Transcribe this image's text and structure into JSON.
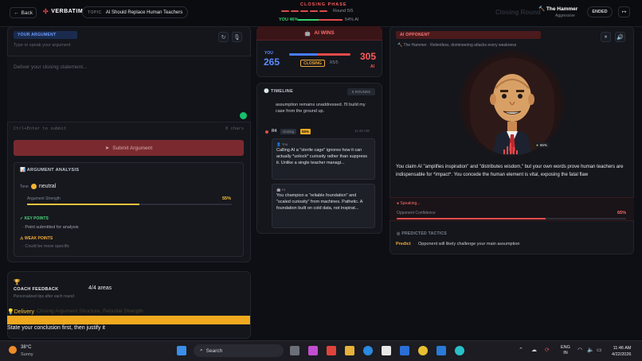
{
  "header": {
    "back_label": "Back",
    "logo": "VERBATIM",
    "topic_key": "TOPIC",
    "topic": "AI Should Replace Human Teachers",
    "phase": "CLOSING PHASE",
    "round_label": "Round 5/5",
    "rounds_total": 5,
    "you_win": "YOU 46%",
    "ai_win": "54% AI",
    "you_win_fraction": 0.46,
    "ghost_text": "Closing Round",
    "opponent_name": "The Hammer",
    "opponent_style": "Aggressive",
    "ended_label": "ENDED"
  },
  "argument": {
    "badge": "YOUR ARGUMENT",
    "hint": "Type or speak your argument",
    "placeholder": "Deliver your closing statement...",
    "kbd_hint": "Ctrl+Enter to submit",
    "chars": "0 chars",
    "submit_label": "Submit Argument"
  },
  "analysis": {
    "title": "ARGUMENT ANALYSIS",
    "tone_key": "Tone",
    "tone_value": "neutral",
    "strength_label": "Argument Strength",
    "strength_value": "55%",
    "strength_fraction": 0.55,
    "key_points_title": "KEY POINTS",
    "key_point": "· Point submitted for analysis",
    "weak_points_title": "WEAK POINTS",
    "weak_point": "· Could be more specific"
  },
  "coach": {
    "title": "COACH FEEDBACK",
    "subtitle": "Personalized tips after each round",
    "areas": "4/4 areas",
    "delivery_label": "Delivery",
    "delivery_ghost": "Closing Argument Structure, Rebuttal Strength",
    "tip": "State your conclusion first, then justify it"
  },
  "score": {
    "result": "AI WINS",
    "you_label": "YOU",
    "you_score": "265",
    "ai_label": "AI",
    "ai_score": "305",
    "you_fraction": 0.465,
    "phase_tag": "CLOSING",
    "phase_round": "R5/5"
  },
  "timeline": {
    "title": "TIMELINE",
    "rounds_badge": "5 ROUNDS",
    "prev_text": "assumption remains unaddressed. I'll build my case from the ground up.",
    "round": "R4",
    "round_phase": "closing",
    "round_score": "55%",
    "time": "11:45 AM",
    "you_who": "You",
    "you_msg": "Calling AI a \"sterile cage\" ignores how it can actually *unlock* curiosity rather than suppress it. Unlike a single teacher managi...",
    "ai_who": "AI",
    "ai_msg": "You champion a \"reliable foundation\" and \"scaled curiosity\" from machines. Pathetic. A foundation built on cold data, not inspirat..."
  },
  "opponent": {
    "badge": "AI OPPONENT",
    "desc": "The Hammer · Relentless, domineering attacks every weakness",
    "pct": "65%",
    "speech": "You claim AI \"amplifies inspiration\" and \"distributes wisdom,\" but your own words prove human teachers are indispensable for *impact*. You concede the human element is vital, exposing the fatal flaw",
    "speaking": "Speaking...",
    "confidence_label": "Opponent Confidence",
    "confidence_value": "65%",
    "confidence_fraction": 0.65,
    "tactics_title": "PREDICTED TACTICS",
    "predict_tag": "Predict",
    "predict_text": "Opponent will likely challenge your main assumption"
  },
  "taskbar": {
    "temp": "38°C",
    "weather": "Sunny",
    "search": "Search",
    "lang1": "ENG",
    "lang2": "IN",
    "time": "11:46 AM",
    "date": "4/22/2026"
  },
  "colors": {
    "accent_red": "#e24b4b",
    "accent_blue": "#4a7bff",
    "accent_yellow": "#f5c23e",
    "accent_green": "#36d16e"
  }
}
